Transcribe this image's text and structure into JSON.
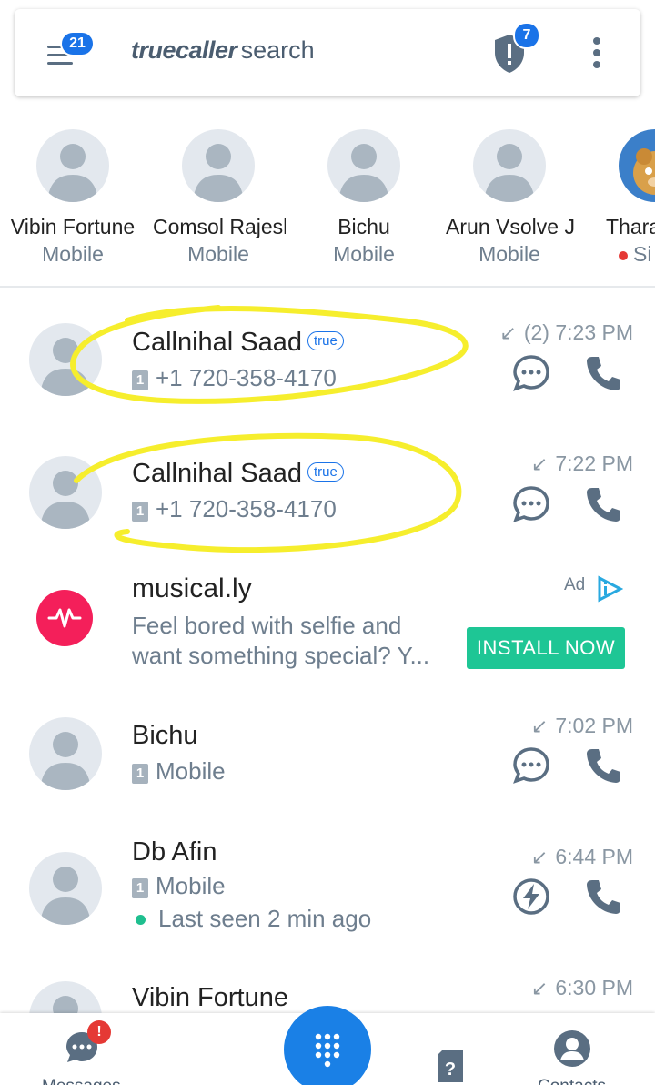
{
  "header": {
    "menu_badge": "21",
    "brand_bold": "truecaller",
    "brand_rest": "search",
    "shield_badge": "7",
    "colors": {
      "accent": "#1a73e8",
      "icon": "#5a6e82"
    }
  },
  "frequent": [
    {
      "name": "Vibin Fortune",
      "sub": "Mobile"
    },
    {
      "name": "Comsol Rajesh",
      "sub": "Mobile"
    },
    {
      "name": "Bichu",
      "sub": "Mobile"
    },
    {
      "name": "Arun Vsolve J",
      "sub": "Mobile"
    },
    {
      "name": "Thara",
      "sub": "Si"
    }
  ],
  "calls": [
    {
      "name": "Callnihal Saad",
      "badge": "true",
      "sub": "+1 720-358-4170",
      "sim": "1",
      "count": "(2)",
      "time": "7:23 PM",
      "arrow": "↙"
    },
    {
      "name": "Callnihal Saad",
      "badge": "true",
      "sub": "+1 720-358-4170",
      "sim": "1",
      "time": "7:22 PM",
      "arrow": "↙"
    },
    {
      "name": "Bichu",
      "sub": "Mobile",
      "sim": "1",
      "time": "7:02 PM",
      "arrow": "↙"
    },
    {
      "name": "Db Afin",
      "sub": "Mobile",
      "sim": "1",
      "status": "Last seen 2 min ago",
      "time": "6:44 PM",
      "arrow": "↙"
    },
    {
      "name": "Vibin Fortune",
      "time": "6:30 PM",
      "arrow": "↙"
    }
  ],
  "ad": {
    "title": "musical.ly",
    "desc_line1": "Feel bored with selfie and",
    "desc_line2": "want something special? Y...",
    "label": "Ad",
    "cta": "INSTALL NOW",
    "cta_color": "#1ec695",
    "brand_color": "#f41f5a"
  },
  "bottom_nav": {
    "messages": "Messages",
    "messages_badge": "!",
    "contacts": "Contacts",
    "dialpad_icon": "dialpad-icon",
    "fab_color": "#1a80e6"
  }
}
